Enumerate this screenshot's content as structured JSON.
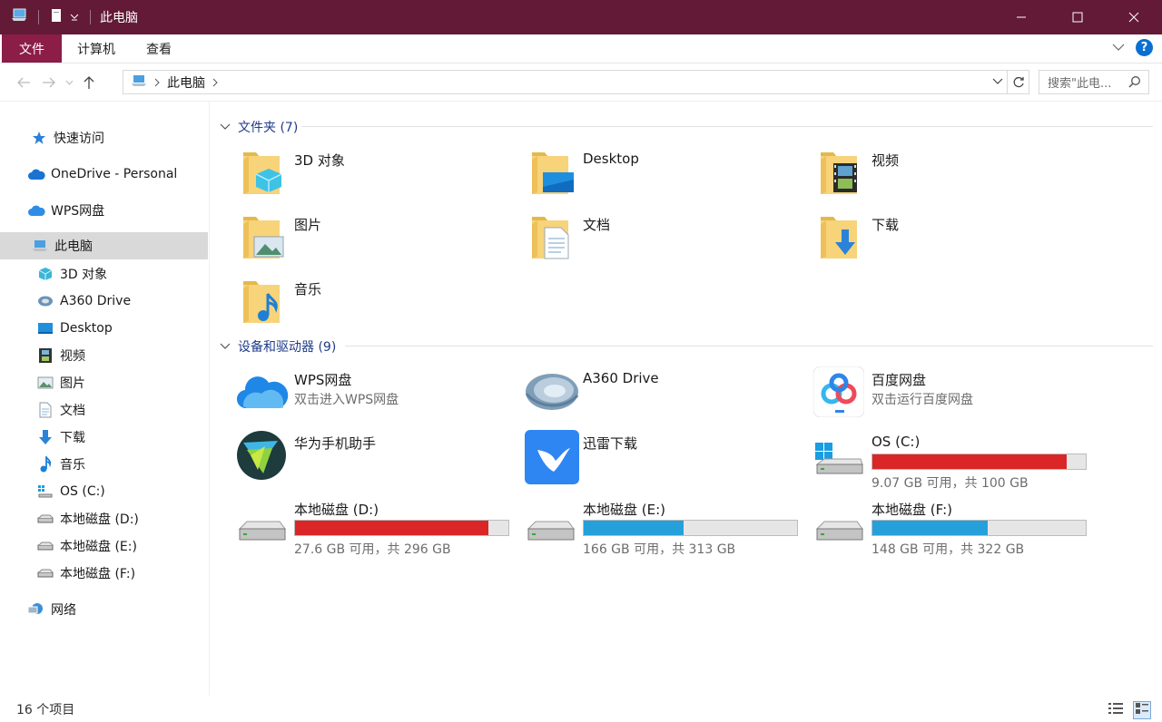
{
  "window": {
    "title": "此电脑"
  },
  "ribbon": {
    "tabs": [
      "文件",
      "计算机",
      "查看"
    ]
  },
  "address": {
    "crumb": "此电脑",
    "search_placeholder": "搜索\"此电..."
  },
  "sidebar": {
    "items": [
      {
        "label": "快速访问",
        "icon": "star-icon"
      },
      {
        "label": "OneDrive - Personal",
        "icon": "cloud-icon"
      },
      {
        "label": "WPS网盘",
        "icon": "wps-cloud-icon"
      },
      {
        "label": "此电脑",
        "icon": "computer-icon"
      },
      {
        "label": "3D 对象",
        "icon": "3d-object-icon"
      },
      {
        "label": "A360 Drive",
        "icon": "a360-icon"
      },
      {
        "label": "Desktop",
        "icon": "desktop-icon"
      },
      {
        "label": "视频",
        "icon": "video-icon"
      },
      {
        "label": "图片",
        "icon": "picture-icon"
      },
      {
        "label": "文档",
        "icon": "document-icon"
      },
      {
        "label": "下载",
        "icon": "download-icon"
      },
      {
        "label": "音乐",
        "icon": "music-icon"
      },
      {
        "label": "OS (C:)",
        "icon": "os-drive-icon"
      },
      {
        "label": "本地磁盘 (D:)",
        "icon": "drive-icon"
      },
      {
        "label": "本地磁盘 (E:)",
        "icon": "drive-icon"
      },
      {
        "label": "本地磁盘 (F:)",
        "icon": "drive-icon"
      },
      {
        "label": "网络",
        "icon": "network-icon"
      }
    ]
  },
  "groups": {
    "folders": {
      "title": "文件夹 (7)"
    },
    "devices": {
      "title": "设备和驱动器 (9)"
    }
  },
  "folders": [
    {
      "name": "3D 对象",
      "icon": "3d-object-folder-icon"
    },
    {
      "name": "Desktop",
      "icon": "desktop-folder-icon"
    },
    {
      "name": "视频",
      "icon": "video-folder-icon"
    },
    {
      "name": "图片",
      "icon": "picture-folder-icon"
    },
    {
      "name": "文档",
      "icon": "document-folder-icon"
    },
    {
      "name": "下载",
      "icon": "download-folder-icon"
    },
    {
      "name": "音乐",
      "icon": "music-folder-icon"
    }
  ],
  "devices": [
    {
      "name": "WPS网盘",
      "sub": "双击进入WPS网盘",
      "icon": "wps-cloud-icon"
    },
    {
      "name": "A360 Drive",
      "sub": "",
      "icon": "a360-icon"
    },
    {
      "name": "百度网盘",
      "sub": "双击运行百度网盘",
      "icon": "baidu-netdisk-icon"
    },
    {
      "name": "华为手机助手",
      "sub": "",
      "icon": "huawei-hisuite-icon"
    },
    {
      "name": "迅雷下载",
      "sub": "",
      "icon": "xunlei-icon"
    },
    {
      "name": "OS (C:)",
      "sub": "9.07 GB 可用，共 100 GB",
      "icon": "os-drive-icon",
      "used_fraction": 0.909,
      "bar_color": "#da2626"
    },
    {
      "name": "本地磁盘 (D:)",
      "sub": "27.6 GB 可用，共 296 GB",
      "icon": "drive-icon",
      "used_fraction": 0.907,
      "bar_color": "#da2626"
    },
    {
      "name": "本地磁盘 (E:)",
      "sub": "166 GB 可用，共 313 GB",
      "icon": "drive-icon",
      "used_fraction": 0.47,
      "bar_color": "#26a0da"
    },
    {
      "name": "本地磁盘 (F:)",
      "sub": "148 GB 可用，共 322 GB",
      "icon": "drive-icon",
      "used_fraction": 0.54,
      "bar_color": "#26a0da"
    }
  ],
  "status": {
    "count": "16 个项目"
  },
  "colors": {
    "titlebar": "#621a36",
    "file_tab": "#8b1d46",
    "accent": "#0b6fcf"
  }
}
